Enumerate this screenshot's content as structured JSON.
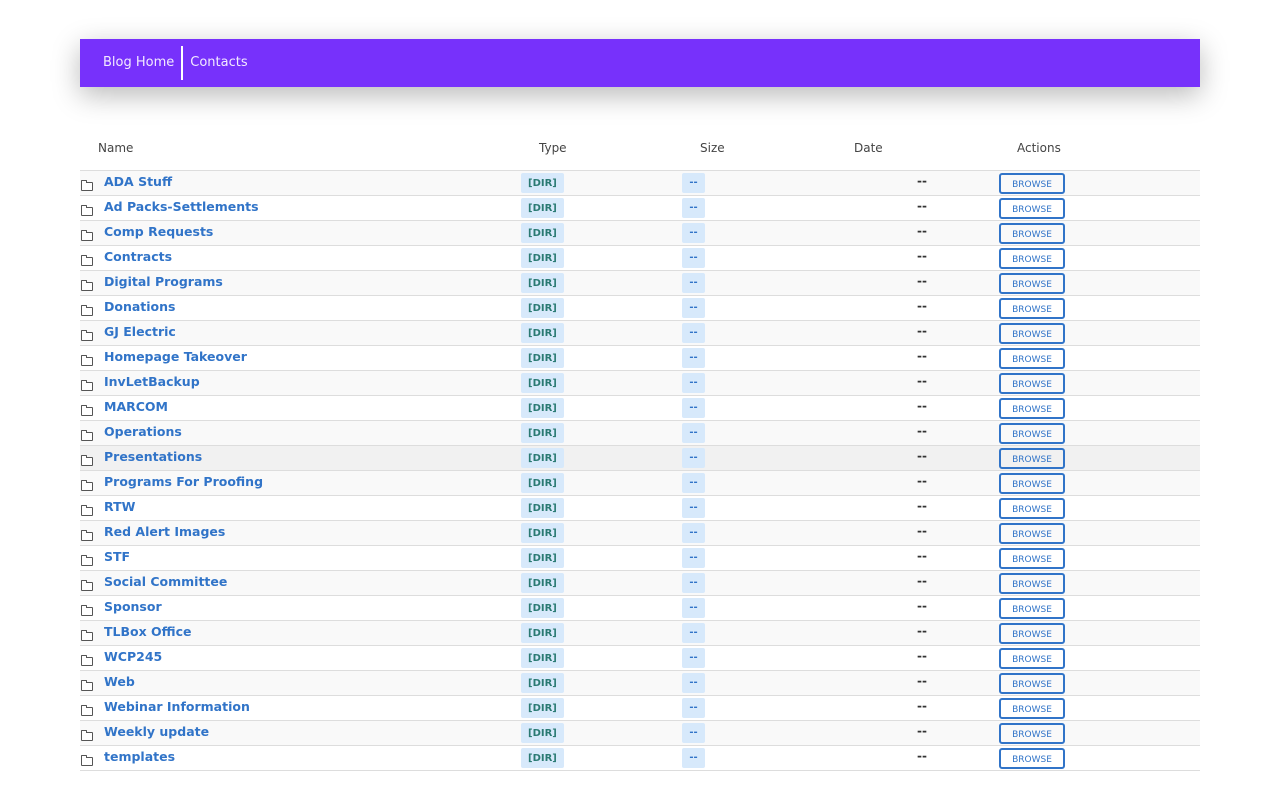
{
  "nav": {
    "items": [
      {
        "label": "Blog Home"
      },
      {
        "label": "Contacts"
      }
    ]
  },
  "table": {
    "headers": {
      "name": "Name",
      "type": "Type",
      "size": "Size",
      "date": "Date",
      "actions": "Actions"
    },
    "rows": [
      {
        "name": "ADA Stuff",
        "type": "[DIR]",
        "size": "--",
        "date": "--",
        "action": "BROWSE"
      },
      {
        "name": "Ad Packs-Settlements",
        "type": "[DIR]",
        "size": "--",
        "date": "--",
        "action": "BROWSE"
      },
      {
        "name": "Comp Requests",
        "type": "[DIR]",
        "size": "--",
        "date": "--",
        "action": "BROWSE"
      },
      {
        "name": "Contracts",
        "type": "[DIR]",
        "size": "--",
        "date": "--",
        "action": "BROWSE"
      },
      {
        "name": "Digital Programs",
        "type": "[DIR]",
        "size": "--",
        "date": "--",
        "action": "BROWSE"
      },
      {
        "name": "Donations",
        "type": "[DIR]",
        "size": "--",
        "date": "--",
        "action": "BROWSE"
      },
      {
        "name": "GJ Electric",
        "type": "[DIR]",
        "size": "--",
        "date": "--",
        "action": "BROWSE"
      },
      {
        "name": "Homepage Takeover",
        "type": "[DIR]",
        "size": "--",
        "date": "--",
        "action": "BROWSE"
      },
      {
        "name": "InvLetBackup",
        "type": "[DIR]",
        "size": "--",
        "date": "--",
        "action": "BROWSE"
      },
      {
        "name": "MARCOM",
        "type": "[DIR]",
        "size": "--",
        "date": "--",
        "action": "BROWSE"
      },
      {
        "name": "Operations",
        "type": "[DIR]",
        "size": "--",
        "date": "--",
        "action": "BROWSE"
      },
      {
        "name": "Presentations",
        "type": "[DIR]",
        "size": "--",
        "date": "--",
        "action": "BROWSE"
      },
      {
        "name": "Programs For Proofing",
        "type": "[DIR]",
        "size": "--",
        "date": "--",
        "action": "BROWSE"
      },
      {
        "name": "RTW",
        "type": "[DIR]",
        "size": "--",
        "date": "--",
        "action": "BROWSE"
      },
      {
        "name": "Red Alert Images",
        "type": "[DIR]",
        "size": "--",
        "date": "--",
        "action": "BROWSE"
      },
      {
        "name": "STF",
        "type": "[DIR]",
        "size": "--",
        "date": "--",
        "action": "BROWSE"
      },
      {
        "name": "Social Committee",
        "type": "[DIR]",
        "size": "--",
        "date": "--",
        "action": "BROWSE"
      },
      {
        "name": "Sponsor",
        "type": "[DIR]",
        "size": "--",
        "date": "--",
        "action": "BROWSE"
      },
      {
        "name": "TLBox Office",
        "type": "[DIR]",
        "size": "--",
        "date": "--",
        "action": "BROWSE"
      },
      {
        "name": "WCP245",
        "type": "[DIR]",
        "size": "--",
        "date": "--",
        "action": "BROWSE"
      },
      {
        "name": "Web",
        "type": "[DIR]",
        "size": "--",
        "date": "--",
        "action": "BROWSE"
      },
      {
        "name": "Webinar Information",
        "type": "[DIR]",
        "size": "--",
        "date": "--",
        "action": "BROWSE"
      },
      {
        "name": "Weekly update",
        "type": "[DIR]",
        "size": "--",
        "date": "--",
        "action": "BROWSE"
      },
      {
        "name": "templates",
        "type": "[DIR]",
        "size": "--",
        "date": "--",
        "action": "BROWSE"
      }
    ],
    "row_icon": "folder-icon",
    "highlighted_row": 11
  },
  "colors": {
    "nav_background": "#7731fb",
    "link": "#3174c8",
    "badge_background": "#d7e9fb",
    "type_text": "#2a7a73"
  }
}
